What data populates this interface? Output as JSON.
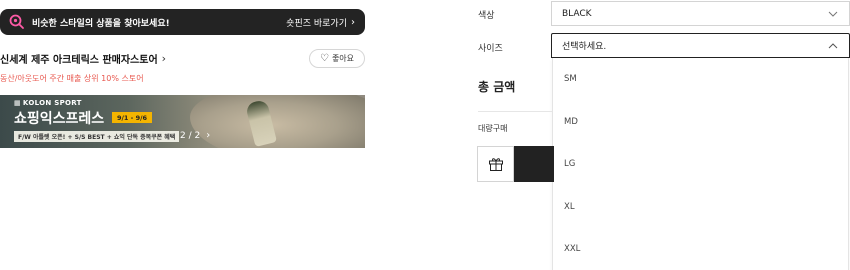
{
  "promo": {
    "text": "비슷한 스타일의 상품을 찾아보세요!",
    "link": "숏핀즈 바로가기"
  },
  "store": {
    "name": "신세계 제주 아크테릭스 판매자스토어",
    "like_label": "좋아요",
    "description": "동산/아웃도어 주간 매출 상위 10% 스토어"
  },
  "banner": {
    "brand": "KOLON SPORT",
    "title": "쇼핑익스프레스",
    "date": "9/1 - 9/6",
    "subtitle": "F/W 아틀렛 오픈! + S/S BEST + 쇼익 단독 증복쿠폰 혜택",
    "pager": "2 / 2"
  },
  "options": {
    "color_label": "색상",
    "color_value": "BLACK",
    "size_label": "사이즈",
    "size_placeholder": "선택하세요.",
    "size_options": [
      "SM",
      "MD",
      "LG",
      "XL",
      "XXL"
    ]
  },
  "purchase": {
    "total_label": "총 금액",
    "bulk_label": "대량구매"
  },
  "colors": {
    "dark": "#232323",
    "accent_red": "#e8584f",
    "promo_icon": "#ff5ba7",
    "date_chip": "#f4b400"
  },
  "icons": {
    "promo": "search-icon",
    "like": "heart-icon",
    "gift": "gift-icon",
    "caret_down": "chevron-down-icon",
    "caret_up": "chevron-up-icon"
  }
}
